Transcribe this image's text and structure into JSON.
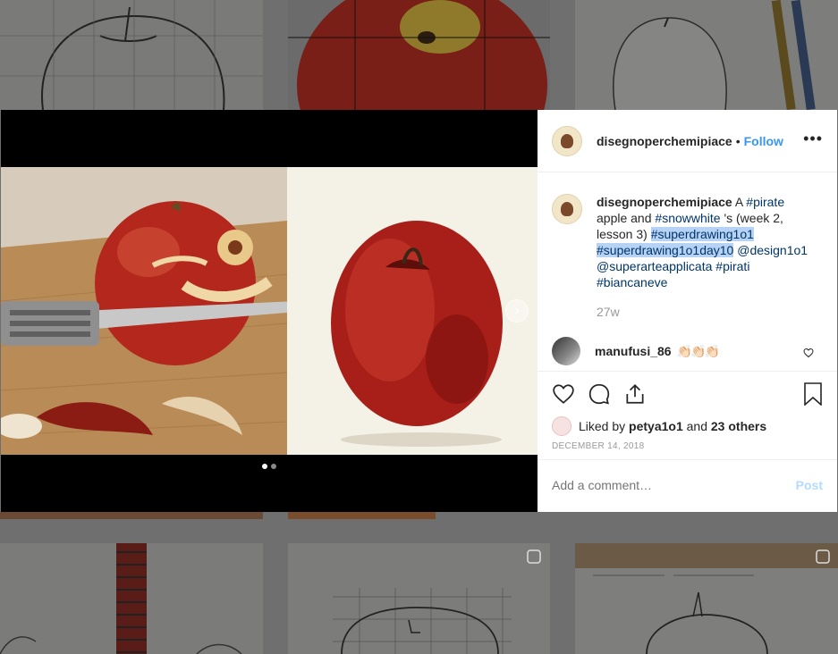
{
  "post": {
    "username": "disegnoperchemipiace",
    "separator": "•",
    "follow_label": "Follow",
    "more_label": "•••",
    "caption": {
      "username": "disegnoperchemipiace",
      "t1": " A ",
      "h_pirate": "#pirate",
      "t2": " apple and ",
      "h_snowwhite": "#snowwhite",
      "t3": " 's (week 2, lesson 3) ",
      "h_sd": "#superdrawing1o1",
      "h_sdday": "#superdrawing1o1day10",
      "m_design": "@design1o1",
      "m_superarte": "@superarteapplicata",
      "h_pirati": "#pirati",
      "h_biancaneve": "#biancaneve"
    },
    "age": "27w",
    "comment": {
      "username": "manufusi_86",
      "emoji": "👏🏻👏🏻👏🏻"
    },
    "liked_by_prefix": "Liked by ",
    "liked_by_user": "petya1o1",
    "liked_by_and": " and ",
    "liked_by_others": "23 others",
    "date": "DECEMBER 14, 2018",
    "add_comment_placeholder": "Add a comment…",
    "post_label": "Post",
    "carousel": {
      "slides": 2,
      "active": 1,
      "next_icon": "chevron-right-icon"
    }
  },
  "icons": [
    "heart-icon",
    "comment-icon",
    "share-icon",
    "bookmark-icon",
    "chevron-right-icon",
    "more-icon"
  ],
  "colors": {
    "link": "#3897f0",
    "hashtag": "#003569",
    "highlight": "#b6d3f5",
    "muted": "#999999"
  }
}
